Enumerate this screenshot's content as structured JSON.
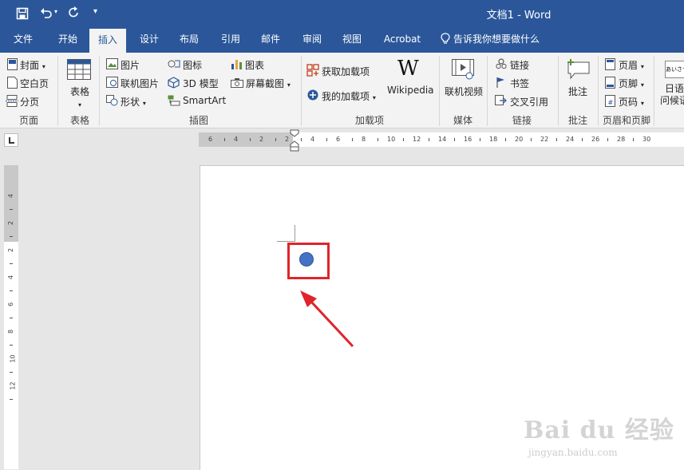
{
  "window": {
    "title": "文档1 - Word",
    "doc_name": "文档1",
    "app_name": "Word"
  },
  "quick_access": {
    "save": "save-icon",
    "undo": "undo-icon",
    "redo": "redo-icon",
    "customize": "▾"
  },
  "tabs": [
    {
      "label": "文件"
    },
    {
      "label": "开始"
    },
    {
      "label": "插入",
      "active": true
    },
    {
      "label": "设计"
    },
    {
      "label": "布局"
    },
    {
      "label": "引用"
    },
    {
      "label": "邮件"
    },
    {
      "label": "审阅"
    },
    {
      "label": "视图"
    },
    {
      "label": "Acrobat"
    }
  ],
  "tell_me": "告诉我你想要做什么",
  "ribbon": {
    "pages": {
      "cover": "封面",
      "blank": "空白页",
      "break": "分页",
      "group": "页面"
    },
    "tables": {
      "table": "表格",
      "group": "表格"
    },
    "illustrations": {
      "picture": "图片",
      "online_picture": "联机图片",
      "shapes": "形状",
      "icons": "图标",
      "model3d": "3D 模型",
      "smartart": "SmartArt",
      "chart": "图表",
      "screenshot": "屏幕截图",
      "group": "插图"
    },
    "addins": {
      "get": "获取加载项",
      "my": "我的加载项",
      "wiki_logo": "W",
      "wikipedia": "Wikipedia",
      "group": "加载项"
    },
    "media": {
      "online_video": "联机视频",
      "group": "媒体"
    },
    "links": {
      "link": "链接",
      "bookmark": "书签",
      "cross_ref": "交叉引用",
      "group": "链接"
    },
    "comments": {
      "comment": "批注",
      "group": "批注"
    },
    "header_footer": {
      "header": "页眉",
      "footer": "页脚",
      "page_number": "页码",
      "group": "页眉和页脚"
    },
    "text_partial": {
      "icon_text": "あいさつ",
      "line1": "日语",
      "line2": "问候语"
    }
  },
  "hruler_labels": [
    "6",
    "4",
    "2",
    "2",
    "4",
    "6",
    "8",
    "10",
    "12",
    "14",
    "16",
    "18",
    "20",
    "22",
    "24",
    "26",
    "28",
    "30"
  ],
  "vruler_labels": [
    "4",
    "2",
    "2",
    "4",
    "6",
    "8",
    "10",
    "12"
  ],
  "watermark": {
    "brand": "Bai du 经验",
    "url": "jingyan.baidu.com"
  },
  "colors": {
    "title_bar": "#2b579a",
    "highlight": "#e0242b",
    "dot": "#4472c4"
  }
}
